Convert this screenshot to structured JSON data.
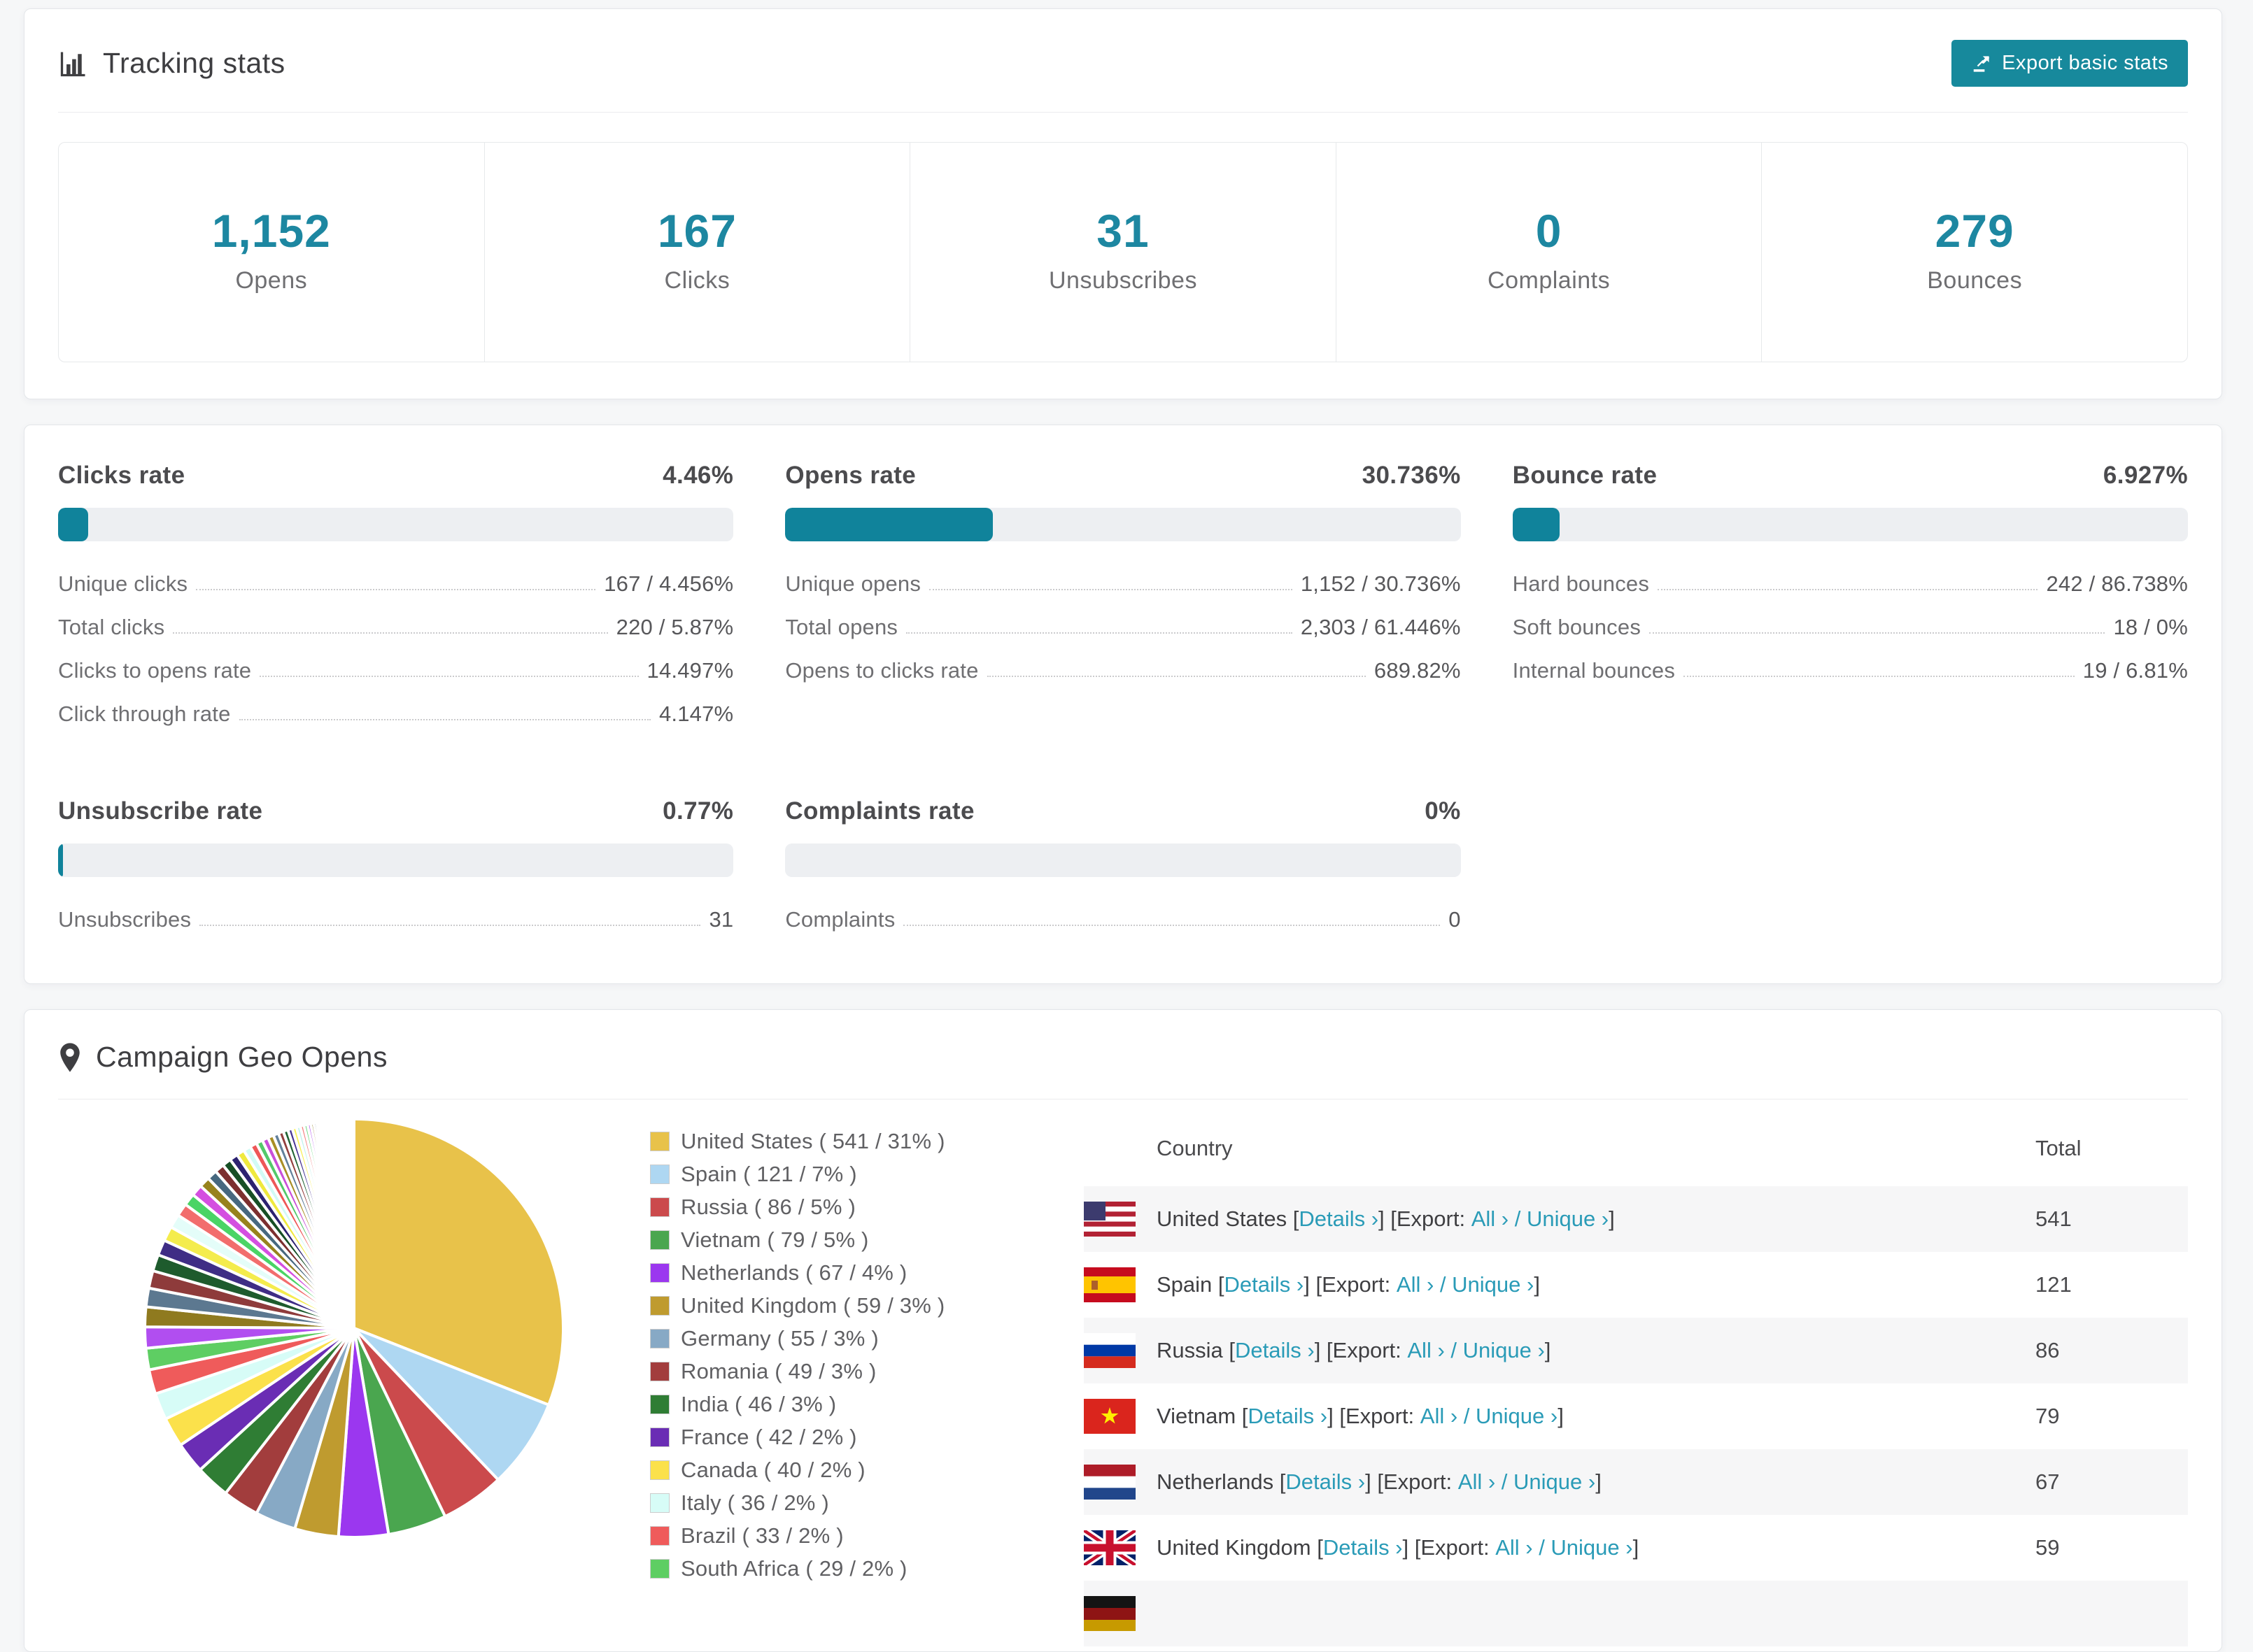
{
  "colors": {
    "accent": "#17899c",
    "link": "#2a9bb7",
    "stat_number": "#1d87a1",
    "bar_fill": "#10839b",
    "bar_track": "#edeff2",
    "row_stripe": "#f6f6f7",
    "palette": [
      "#e8c24a",
      "#aed7f2",
      "#cb4a4c",
      "#4aa64f",
      "#9b37ef",
      "#bf9b2f",
      "#87a9c5",
      "#a23d3d",
      "#2f7d34",
      "#6a2db4",
      "#fbe14b",
      "#d7fcf7",
      "#ef5b5b",
      "#5ece63"
    ],
    "palette_extra": [
      "#b14ef0",
      "#8f7a1f",
      "#5c7890",
      "#8e3b3b",
      "#1e5b2d",
      "#3f2d85",
      "#f4ec4d",
      "#e4fdf9",
      "#f26d6d",
      "#4ad465",
      "#d44fe0",
      "#97821d",
      "#47687f",
      "#7c2f2f",
      "#174f25",
      "#2c2270",
      "#efe93e",
      "#d2fbf6",
      "#ee5757",
      "#53c96a",
      "#c94fd9",
      "#a98e25",
      "#62809a",
      "#933f3f",
      "#226334",
      "#4a3694",
      "#f8f056",
      "#bff2ec",
      "#f47f7f",
      "#66d97a"
    ]
  },
  "tracking": {
    "title": "Tracking stats",
    "export_button": "Export basic stats",
    "stats": [
      {
        "value": "1,152",
        "label": "Opens"
      },
      {
        "value": "167",
        "label": "Clicks"
      },
      {
        "value": "31",
        "label": "Unsubscribes"
      },
      {
        "value": "0",
        "label": "Complaints"
      },
      {
        "value": "279",
        "label": "Bounces"
      }
    ]
  },
  "rates": [
    {
      "title": "Clicks rate",
      "value": "4.46%",
      "bar_pct": 4.46,
      "rows": [
        {
          "label": "Unique clicks",
          "value": "167 / 4.456%"
        },
        {
          "label": "Total clicks",
          "value": "220 / 5.87%"
        },
        {
          "label": "Clicks to opens rate",
          "value": "14.497%"
        },
        {
          "label": "Click through rate",
          "value": "4.147%"
        }
      ]
    },
    {
      "title": "Opens rate",
      "value": "30.736%",
      "bar_pct": 30.736,
      "rows": [
        {
          "label": "Unique opens",
          "value": "1,152 / 30.736%"
        },
        {
          "label": "Total opens",
          "value": "2,303 / 61.446%"
        },
        {
          "label": "Opens to clicks rate",
          "value": "689.82%"
        }
      ]
    },
    {
      "title": "Bounce rate",
      "value": "6.927%",
      "bar_pct": 6.927,
      "rows": [
        {
          "label": "Hard bounces",
          "value": "242 / 86.738%"
        },
        {
          "label": "Soft bounces",
          "value": "18 / 0%"
        },
        {
          "label": "Internal bounces",
          "value": "19 / 6.81%"
        }
      ]
    },
    {
      "title": "Unsubscribe rate",
      "value": "0.77%",
      "bar_pct": 0.77,
      "rows": [
        {
          "label": "Unsubscribes",
          "value": "31"
        }
      ]
    },
    {
      "title": "Complaints rate",
      "value": "0%",
      "bar_pct": 0,
      "rows": [
        {
          "label": "Complaints",
          "value": "0"
        }
      ]
    }
  ],
  "geo": {
    "title": "Campaign Geo Opens",
    "table": {
      "columns": [
        "Country",
        "Total"
      ],
      "details_label": "Details ›",
      "export_label": "Export:",
      "all_label": "All ›",
      "unique_label": "Unique ›",
      "rows": [
        {
          "country": "United States",
          "flag": "us",
          "total": "541",
          "partial": false
        },
        {
          "country": "Spain",
          "flag": "es",
          "total": "121",
          "partial": false
        },
        {
          "country": "Russia",
          "flag": "ru",
          "total": "86",
          "partial": false
        },
        {
          "country": "Vietnam",
          "flag": "vn",
          "total": "79",
          "partial": false
        },
        {
          "country": "Netherlands",
          "flag": "nl",
          "total": "67",
          "partial": false
        },
        {
          "country": "United Kingdom",
          "flag": "gb",
          "total": "59",
          "partial": false
        },
        {
          "country": "",
          "flag": "dark",
          "total": "",
          "partial": true
        }
      ]
    }
  },
  "chart_data": {
    "type": "pie",
    "title": "Campaign Geo Opens",
    "legend_position": "right",
    "entries": [
      {
        "label": "United States",
        "value": 541,
        "pct": 31
      },
      {
        "label": "Spain",
        "value": 121,
        "pct": 7
      },
      {
        "label": "Russia",
        "value": 86,
        "pct": 5
      },
      {
        "label": "Vietnam",
        "value": 79,
        "pct": 5
      },
      {
        "label": "Netherlands",
        "value": 67,
        "pct": 4
      },
      {
        "label": "United Kingdom",
        "value": 59,
        "pct": 3
      },
      {
        "label": "Germany",
        "value": 55,
        "pct": 3
      },
      {
        "label": "Romania",
        "value": 49,
        "pct": 3
      },
      {
        "label": "India",
        "value": 46,
        "pct": 3
      },
      {
        "label": "France",
        "value": 42,
        "pct": 2
      },
      {
        "label": "Canada",
        "value": 40,
        "pct": 2
      },
      {
        "label": "Italy",
        "value": 36,
        "pct": 2
      },
      {
        "label": "Brazil",
        "value": 33,
        "pct": 2
      },
      {
        "label": "South Africa",
        "value": 29,
        "pct": 2
      }
    ],
    "others_total_estimated": 462,
    "others_note": "remaining ~26% split across many small unlabeled slices"
  }
}
